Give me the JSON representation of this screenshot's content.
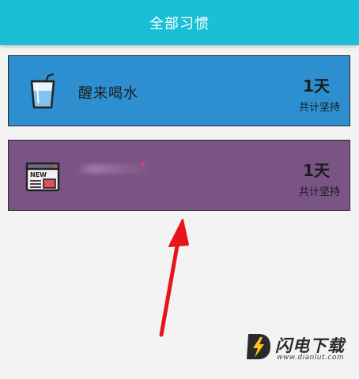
{
  "app_bar": {
    "title": "全部习惯"
  },
  "habits": [
    {
      "name": "醒来喝水",
      "days": "1天",
      "subtitle": "共计坚持",
      "color": "#2d8fd0",
      "icon": "water-glass-icon"
    },
    {
      "name": "",
      "days": "1天",
      "subtitle": "共计坚持",
      "color": "#7a5485",
      "icon": "news-icon",
      "icon_label": "NEW"
    }
  ],
  "watermark": {
    "brand": "闪电下载",
    "url": "www.dianlut.com",
    "logo_letter": "D"
  },
  "annotation": {
    "arrow_color": "#e8141a"
  }
}
